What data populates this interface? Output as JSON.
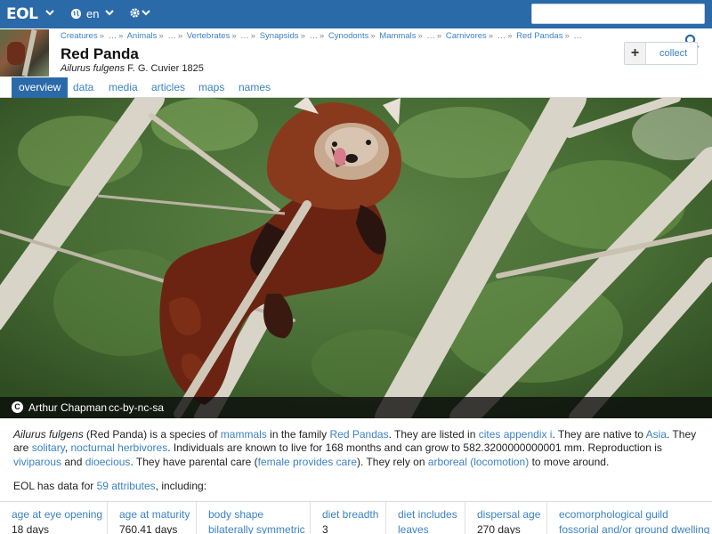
{
  "topbar": {
    "logo": "EOL",
    "language": "en",
    "search_placeholder": ""
  },
  "header": {
    "breadcrumbs": [
      "Creatures",
      "…",
      "Animals",
      "…",
      "Vertebrates",
      "…",
      "Synapsids",
      "…",
      "Cynodonts",
      "Mammals",
      "…",
      "Carnivores",
      "…",
      "Red Pandas",
      "…"
    ],
    "title": "Red Panda",
    "scientific_name": "Ailurus fulgens",
    "authority": "F. G. Cuvier 1825",
    "collect_label": "collect",
    "collect_plus": "+"
  },
  "tabs": [
    "overview",
    "data",
    "media",
    "articles",
    "maps",
    "names"
  ],
  "hero": {
    "author": "Arthur Chapman",
    "license": "cc-by-nc-sa",
    "cc_symbol": "C"
  },
  "summary": {
    "sci": "Ailurus fulgens",
    "t1": " (Red Panda) is a species of ",
    "l1": "mammals",
    "t2": " in the family ",
    "l2": "Red Pandas",
    "t3": ". They are listed in ",
    "l3": "cites appendix i",
    "t4": ". They are native to ",
    "l4": "Asia",
    "t5": ". They are ",
    "l5": "solitary",
    "t6": ", ",
    "l6": "nocturnal herbivores",
    "t7": ". Individuals are known to live for 168 months and can grow to 582.3200000000001 mm. Reproduction is ",
    "l7": "viviparous",
    "t8": " and ",
    "l8": "dioecious",
    "t9": ". They have parental care (",
    "l9": "female provides care",
    "t10": "). They rely on ",
    "l10": "arboreal (locomotion)",
    "t11": " to move around."
  },
  "data_count": {
    "prefix": "EOL has data for ",
    "link": "59 attributes",
    "suffix": ", including:"
  },
  "attributes": [
    {
      "name": "age at eye opening",
      "value": "18 days",
      "value_link": false
    },
    {
      "name": "age at maturity",
      "value": "760.41 days",
      "value_link": false
    },
    {
      "name": "body shape",
      "value": "bilaterally symmetric",
      "value_link": true
    },
    {
      "name": "diet breadth",
      "value": "3",
      "value_link": false
    },
    {
      "name": "diet includes",
      "value": "leaves",
      "value_link": true
    },
    {
      "name": "dispersal age",
      "value": "270 days",
      "value_link": false
    },
    {
      "name": "ecomorphological guild",
      "value": "fossorial and/or ground dwelling",
      "value_link": true
    }
  ],
  "colors": {
    "brand": "#2b6aa9",
    "link": "#3b82c4"
  }
}
